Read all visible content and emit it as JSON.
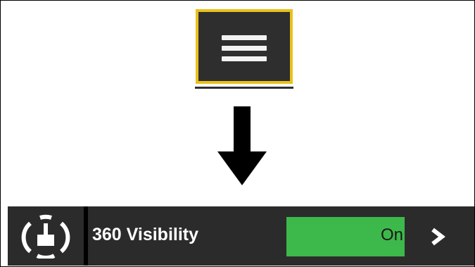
{
  "menu": {
    "icon": "hamburger-icon",
    "highlight_color": "#e8c11c",
    "background_color": "#2e2e2e"
  },
  "arrow": {
    "icon": "arrow-down-icon"
  },
  "setting": {
    "icon": "360-visibility-icon",
    "label": "360 Visibility",
    "toggle_value": "On",
    "toggle_color": "#3db84a",
    "chevron_icon": "chevron-right-icon"
  }
}
